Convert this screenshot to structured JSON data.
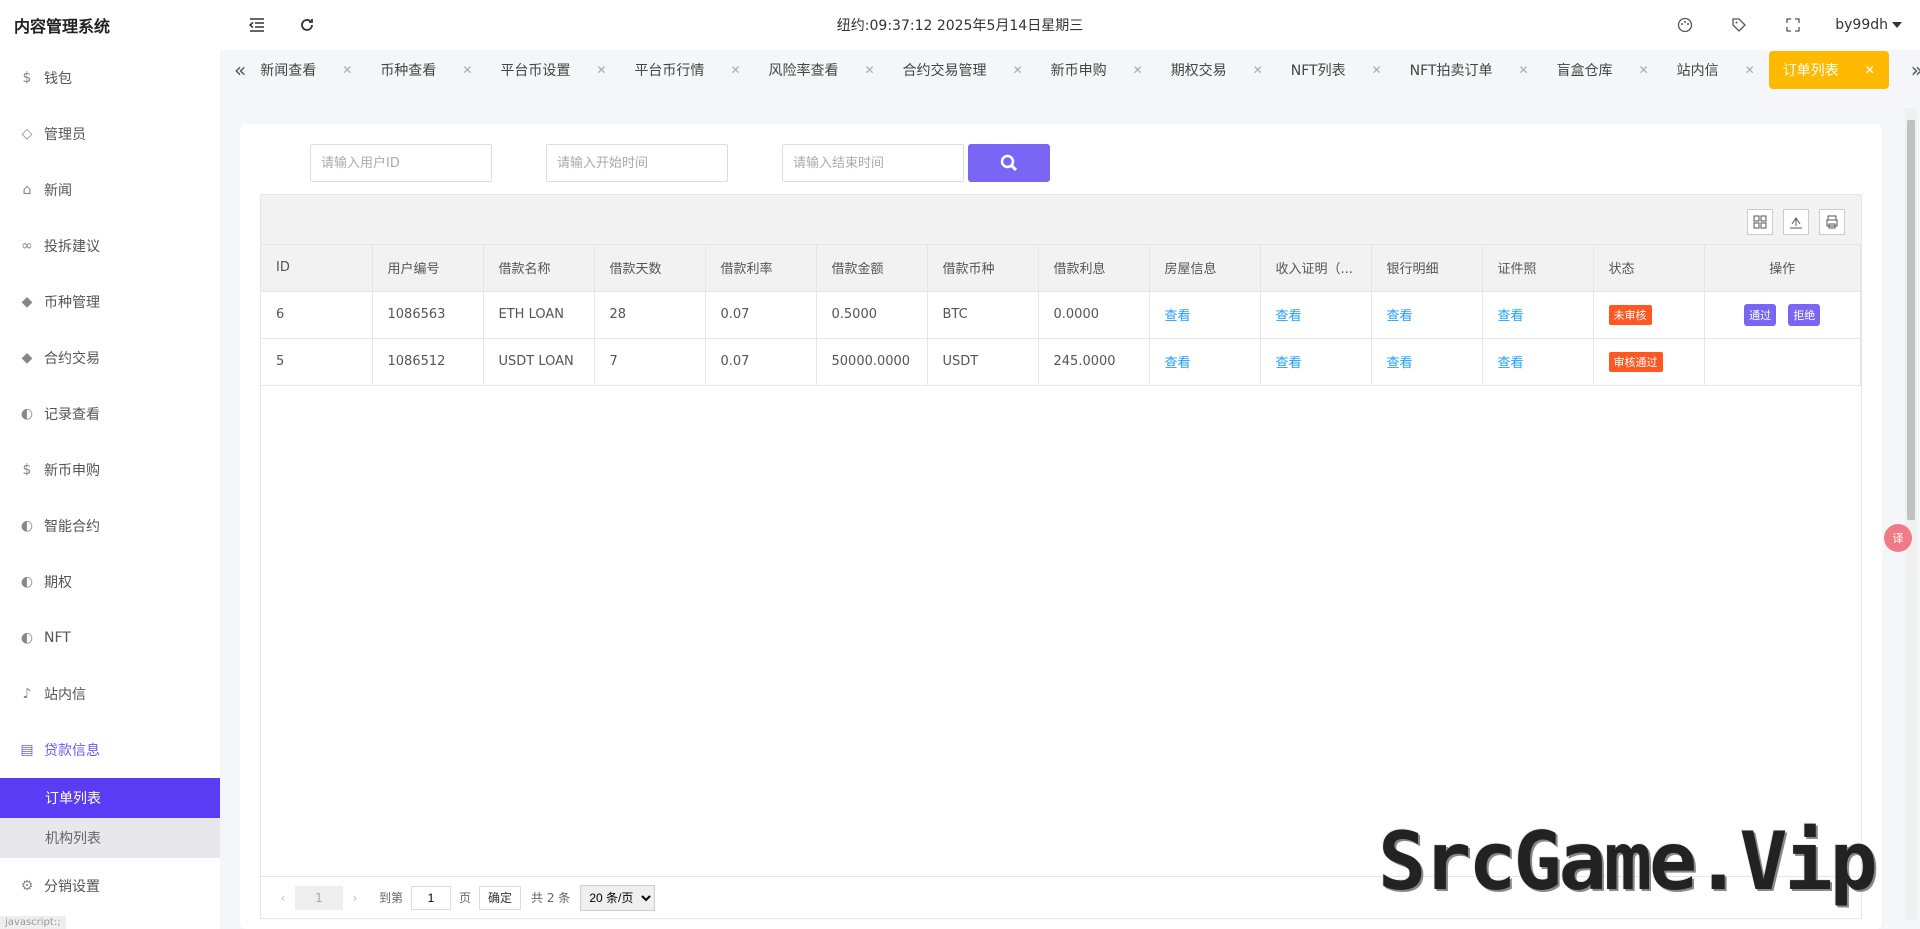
{
  "app": {
    "title": "内容管理系统"
  },
  "header": {
    "clock": "纽约:09:37:12 2025年5月14日星期三",
    "user": "by99dh"
  },
  "sidebar": {
    "items": [
      {
        "label": "钱包",
        "icon": "dollar-circle-icon"
      },
      {
        "label": "管理员",
        "icon": "shield-icon"
      },
      {
        "label": "新闻",
        "icon": "tag-icon"
      },
      {
        "label": "投拆建议",
        "icon": "link-icon"
      },
      {
        "label": "币种管理",
        "icon": "diamond-icon"
      },
      {
        "label": "合约交易",
        "icon": "diamond-icon"
      },
      {
        "label": "记录查看",
        "icon": "circle-arrow-icon"
      },
      {
        "label": "新币申购",
        "icon": "dollar-circle-icon"
      },
      {
        "label": "智能合约",
        "icon": "circle-arrow-icon"
      },
      {
        "label": "期权",
        "icon": "circle-arrow-icon"
      },
      {
        "label": "NFT",
        "icon": "circle-arrow-icon"
      },
      {
        "label": "站内信",
        "icon": "bell-icon"
      },
      {
        "label": "贷款信息",
        "icon": "document-icon"
      }
    ],
    "sub_items": [
      {
        "label": "订单列表"
      },
      {
        "label": "机构列表"
      }
    ],
    "after": {
      "label": "分销设置",
      "icon": "gear-icon"
    },
    "status_text": "javascript:;"
  },
  "tabs": [
    {
      "label": "新闻查看"
    },
    {
      "label": "币种查看"
    },
    {
      "label": "平台币设置"
    },
    {
      "label": "平台币行情"
    },
    {
      "label": "风险率查看"
    },
    {
      "label": "合约交易管理"
    },
    {
      "label": "新币申购"
    },
    {
      "label": "期权交易"
    },
    {
      "label": "NFT列表"
    },
    {
      "label": "NFT拍卖订单"
    },
    {
      "label": "盲盒仓库"
    },
    {
      "label": "站内信"
    },
    {
      "label": "订单列表"
    }
  ],
  "search": {
    "user_id_placeholder": "请输入用户ID",
    "start_placeholder": "请输入开始时间",
    "end_placeholder": "请输入结束时间"
  },
  "table": {
    "columns": [
      "ID",
      "用户编号",
      "借款名称",
      "借款天数",
      "借款利率",
      "借款金额",
      "借款币种",
      "借款利息",
      "房屋信息",
      "收入证明（...",
      "银行明细",
      "证件照",
      "状态",
      "操作"
    ],
    "rows": [
      {
        "id": "6",
        "user": "1086563",
        "name": "ETH LOAN",
        "days": "28",
        "rate": "0.07",
        "amount": "0.5000",
        "currency": "BTC",
        "interest": "0.0000",
        "house": "查看",
        "income": "查看",
        "bank": "查看",
        "idphoto": "查看",
        "status": "未审核",
        "approve": "通过",
        "reject": "拒绝"
      },
      {
        "id": "5",
        "user": "1086512",
        "name": "USDT LOAN",
        "days": "7",
        "rate": "0.07",
        "amount": "50000.0000",
        "currency": "USDT",
        "interest": "245.0000",
        "house": "查看",
        "income": "查看",
        "bank": "查看",
        "idphoto": "查看",
        "status": "审核通过"
      }
    ]
  },
  "pager": {
    "current": "1",
    "goto_label": "到第",
    "goto_value": "1",
    "page_unit": "页",
    "confirm": "确定",
    "total": "共 2 条",
    "page_size": "20 条/页"
  },
  "float_button": "译",
  "watermark": "SrcGame.Vip",
  "colors": {
    "accent": "#5a3cf5",
    "active_tab": "#ffb900",
    "link": "#1e9fff",
    "badge": "#ff5722"
  }
}
